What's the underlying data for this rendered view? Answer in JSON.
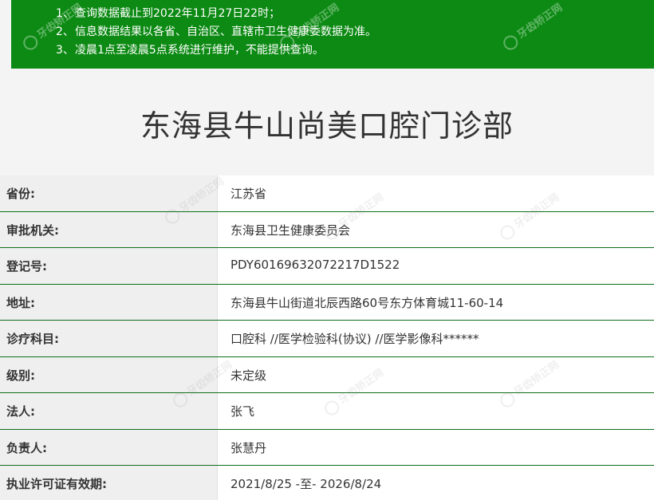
{
  "notice": {
    "lines": [
      {
        "num": "1、",
        "text": "查询数据截止到2022年11月27日22时；"
      },
      {
        "num": "2、",
        "text": "信息数据结果以各省、自治区、直辖市卫生健康委数据为准。"
      },
      {
        "num": "3、",
        "text": "凌晨1点至凌晨5点系统进行维护，不能提供查询。"
      }
    ],
    "background_color": "#0c8a13"
  },
  "title": "东海县牛山尚美口腔门诊部",
  "watermark_text": "牙齿矫正网",
  "rows": [
    {
      "label": "省份:",
      "value": "江苏省"
    },
    {
      "label": "审批机关:",
      "value": "东海县卫生健康委员会"
    },
    {
      "label": "登记号:",
      "value": "PDY60169632072217D1522"
    },
    {
      "label": "地址:",
      "value": "东海县牛山街道北辰西路60号东方体育城11-60-14"
    },
    {
      "label": "诊疗科目:",
      "value": "口腔科 //医学检验科(协议) //医学影像科******"
    },
    {
      "label": "级别:",
      "value": "未定级"
    },
    {
      "label": "法人:",
      "value": "张飞"
    },
    {
      "label": "负责人:",
      "value": "张慧丹"
    },
    {
      "label": "执业许可证有效期:",
      "value": "2021/8/25 -至- 2026/8/24"
    }
  ],
  "colors": {
    "notice_bg": "#0c8a13",
    "row_divider": "#0f6e1a",
    "label_bg": "#efefef",
    "value_bg": "#ffffff"
  }
}
